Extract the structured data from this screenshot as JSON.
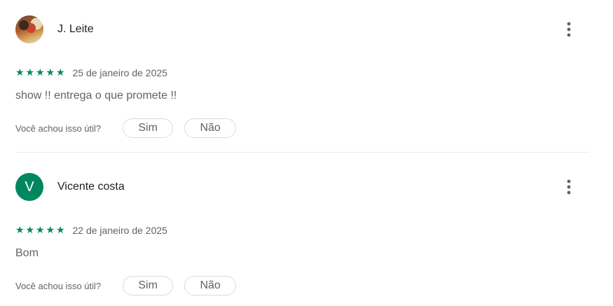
{
  "reviews": [
    {
      "name": "J. Leite",
      "avatar": {
        "type": "photo"
      },
      "rating": 5,
      "stars": [
        "★",
        "★",
        "★",
        "★",
        "★"
      ],
      "date": "25 de janeiro de 2025",
      "text": "show !! entrega o que promete !!",
      "helpful_prompt": "Você achou isso útil?",
      "yes_label": "Sim",
      "no_label": "Não",
      "menu_icon": "more-vert-icon"
    },
    {
      "name": "Vicente costa",
      "avatar": {
        "type": "letter",
        "letter": "V",
        "color": "#01875f"
      },
      "rating": 5,
      "stars": [
        "★",
        "★",
        "★",
        "★",
        "★"
      ],
      "date": "22 de janeiro de 2025",
      "text": "Bom",
      "helpful_prompt": "Você achou isso útil?",
      "yes_label": "Sim",
      "no_label": "Não",
      "menu_icon": "more-vert-icon"
    }
  ],
  "colors": {
    "star": "#01875f",
    "text_primary": "#202124",
    "text_secondary": "#5f6368",
    "divider": "#e8eaed"
  }
}
